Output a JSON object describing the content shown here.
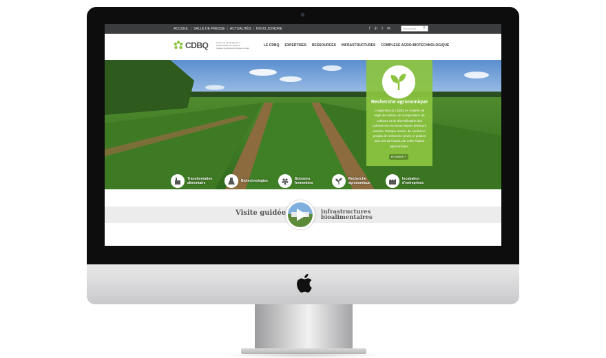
{
  "top_bar": {
    "links": [
      "ACCUEIL",
      "SALLE DE PRESSE",
      "ACTUALITÉS",
      "NOUS JOINDRE"
    ],
    "social_icons": [
      "facebook-icon",
      "linkedin-icon",
      "twitter-icon",
      "mail-icon"
    ],
    "search_placeholder": "Recherche"
  },
  "header": {
    "logo_text": "CDBQ",
    "logo_tagline": [
      "Centre de développement",
      "bioalimentaire du Québec",
      "Québec Agrobiotechnologies Center"
    ],
    "nav": [
      "LE CDBQ",
      "EXPERTISES",
      "RESSOURCES",
      "INFRASTRUCTURES",
      "COMPLEXE AGRO-BIOTECHNOLOGIQUE"
    ]
  },
  "promo": {
    "title": "Recherche agronomique",
    "body": "L'expertise du CDBQ en matière de régie de culture, de comparaison de cultivars et de diversification des cultures est reconnue depuis plusieurs années. Chaque année, de nombreux projets de recherche privés et publics sont mis de l'avant par notre équipe agronomique.",
    "button": "en savoir +"
  },
  "expertises": [
    {
      "label_1": "Transformation",
      "label_2": "alimentaire"
    },
    {
      "label_1": "Biotechnologies",
      "label_2": ""
    },
    {
      "label_1": "Boissons",
      "label_2": "fermentées"
    },
    {
      "label_1": "Recherche",
      "label_2": "agronomique"
    },
    {
      "label_1": "Incubation",
      "label_2": "d'entreprises"
    }
  ],
  "visit": {
    "left": "Visite guidée",
    "right_1": "infrastructures",
    "right_2": "bioalimentaires"
  },
  "colors": {
    "accent": "#8cc43f",
    "top_bar": "#3b3c3e",
    "band": "#ececec"
  }
}
